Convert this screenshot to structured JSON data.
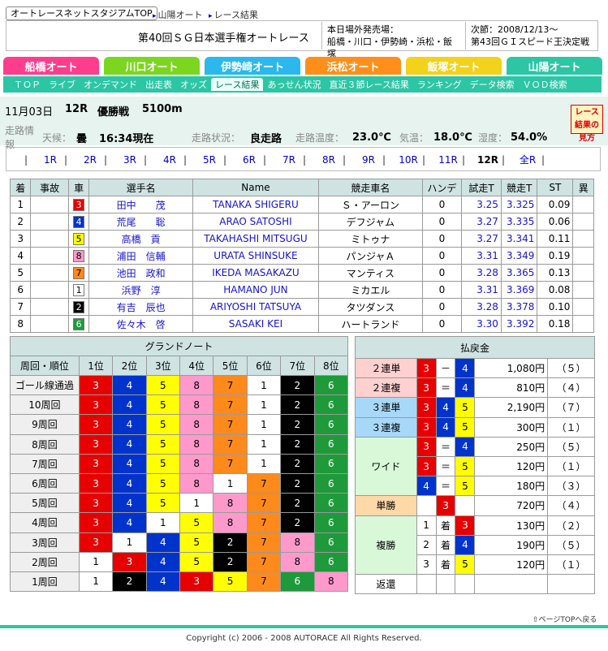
{
  "top": {
    "home_btn": "オートレースネットスタジアムTOP",
    "crumb1": "山陽オート",
    "crumb2": "レース結果"
  },
  "title": "第40回ＳＧ日本選手権オートレース",
  "outside": {
    "label": "本日場外発売場：",
    "venues": "船橋・川口・伊勢崎・浜松・飯塚"
  },
  "next": {
    "label": "次節：2008/12/13～",
    "name": "第43回ＧＩスピード王決定戦"
  },
  "tabs": [
    {
      "label": "船橋オート",
      "color": "#ff3d8c"
    },
    {
      "label": "川口オート",
      "color": "#7cd620"
    },
    {
      "label": "伊勢崎オート",
      "color": "#2ab8ef"
    },
    {
      "label": "浜松オート",
      "color": "#ff8f1a"
    },
    {
      "label": "飯塚オート",
      "color": "#f2d21a"
    },
    {
      "label": "山陽オート",
      "color": "#2cc6a4"
    }
  ],
  "subnav": [
    "ＴＯＰ",
    "ライブ",
    "オンデマンド",
    "出走表",
    "オッズ",
    "レース結果",
    "あっせん状況",
    "直近３節レース結果",
    "ランキング",
    "データ検索",
    "ＶＯＤ検索"
  ],
  "race": {
    "date": "11月03日",
    "no": "12R",
    "type": "優勝戦",
    "dist": "5100m"
  },
  "cond": {
    "info_label": "走路情報",
    "weather_label": "天候：",
    "weather": "曇",
    "time": "16:34現在",
    "state_label": "走路状況：",
    "state": "良走路",
    "temp_label": "走路温度：",
    "temp": "23.0℃",
    "air_label": "気温：",
    "air": "18.0℃",
    "hum_label": "湿度：",
    "hum": "54.0%"
  },
  "guide_btn": "レース結果の見方",
  "races": [
    "1R",
    "2R",
    "3R",
    "4R",
    "5R",
    "6R",
    "7R",
    "8R",
    "9R",
    "10R",
    "11R",
    "12R",
    "全R"
  ],
  "results": {
    "headers": [
      "着",
      "事故",
      "車",
      "選手名",
      "Name",
      "競走車名",
      "ハンデ",
      "試走T",
      "競走T",
      "ST",
      "異"
    ],
    "rows": [
      {
        "pos": "1",
        "car": "3",
        "cc": "c3",
        "name": "田中　　茂",
        "en": "TANAKA SHIGERU",
        "bike": "Ｓ・アーロン",
        "handi": "0",
        "trial": "3.25",
        "race": "3.325",
        "st": "0.09"
      },
      {
        "pos": "2",
        "car": "4",
        "cc": "c4",
        "name": "荒尾　　聡",
        "en": "ARAO SATOSHI",
        "bike": "デフジャム",
        "handi": "0",
        "trial": "3.27",
        "race": "3.335",
        "st": "0.06"
      },
      {
        "pos": "3",
        "car": "5",
        "cc": "c5",
        "name": "高橋　貢",
        "en": "TAKAHASHI MITSUGU",
        "bike": "ミトゥナ",
        "handi": "0",
        "trial": "3.27",
        "race": "3.341",
        "st": "0.11"
      },
      {
        "pos": "4",
        "car": "8",
        "cc": "c8",
        "name": "浦田　信輔",
        "en": "URATA SHINSUKE",
        "bike": "パンジャＡ",
        "handi": "0",
        "trial": "3.31",
        "race": "3.349",
        "st": "0.19"
      },
      {
        "pos": "5",
        "car": "7",
        "cc": "c7",
        "name": "池田　政和",
        "en": "IKEDA MASAKAZU",
        "bike": "マンティス",
        "handi": "0",
        "trial": "3.28",
        "race": "3.365",
        "st": "0.13"
      },
      {
        "pos": "6",
        "car": "1",
        "cc": "c1",
        "name": "浜野　淳",
        "en": "HAMANO JUN",
        "bike": "ミカエル",
        "handi": "0",
        "trial": "3.31",
        "race": "3.369",
        "st": "0.08"
      },
      {
        "pos": "7",
        "car": "2",
        "cc": "c2",
        "name": "有吉　辰也",
        "en": "ARIYOSHI TATSUYA",
        "bike": "タツダンス",
        "handi": "0",
        "trial": "3.28",
        "race": "3.378",
        "st": "0.10"
      },
      {
        "pos": "8",
        "car": "6",
        "cc": "c6",
        "name": "佐々木　啓",
        "en": "SASAKI KEI",
        "bike": "ハートランド",
        "handi": "0",
        "trial": "3.30",
        "race": "3.392",
        "st": "0.18"
      }
    ]
  },
  "grand": {
    "title": "グランドノート",
    "head": [
      "周回・順位",
      "1位",
      "2位",
      "3位",
      "4位",
      "5位",
      "6位",
      "7位",
      "8位"
    ],
    "rows": [
      {
        "label": "ゴール線通過",
        "v": [
          "3",
          "4",
          "5",
          "8",
          "7",
          "1",
          "2",
          "6"
        ]
      },
      {
        "label": "10周回",
        "v": [
          "3",
          "4",
          "5",
          "8",
          "7",
          "1",
          "2",
          "6"
        ]
      },
      {
        "label": "9周回",
        "v": [
          "3",
          "4",
          "5",
          "8",
          "7",
          "1",
          "2",
          "6"
        ]
      },
      {
        "label": "8周回",
        "v": [
          "3",
          "4",
          "5",
          "8",
          "7",
          "1",
          "2",
          "6"
        ]
      },
      {
        "label": "7周回",
        "v": [
          "3",
          "4",
          "5",
          "8",
          "7",
          "1",
          "2",
          "6"
        ]
      },
      {
        "label": "6周回",
        "v": [
          "3",
          "4",
          "5",
          "8",
          "1",
          "7",
          "2",
          "6"
        ]
      },
      {
        "label": "5周回",
        "v": [
          "3",
          "4",
          "5",
          "1",
          "8",
          "7",
          "2",
          "6"
        ]
      },
      {
        "label": "4周回",
        "v": [
          "3",
          "4",
          "1",
          "5",
          "8",
          "7",
          "2",
          "6"
        ]
      },
      {
        "label": "3周回",
        "v": [
          "3",
          "1",
          "4",
          "5",
          "2",
          "7",
          "8",
          "6"
        ]
      },
      {
        "label": "2周回",
        "v": [
          "1",
          "3",
          "4",
          "5",
          "2",
          "7",
          "8",
          "6"
        ]
      },
      {
        "label": "1周回",
        "v": [
          "1",
          "2",
          "4",
          "3",
          "5",
          "7",
          "6",
          "8"
        ]
      }
    ]
  },
  "payout": {
    "title": "払戻金",
    "rows": [
      {
        "type": "２連単",
        "bg": "#ffd0d0",
        "a": "3",
        "sep": "－",
        "b": "4",
        "c": "",
        "amt": "1,080円",
        "pop": "（５）"
      },
      {
        "type": "２連複",
        "bg": "#ffd0d0",
        "a": "3",
        "sep": "＝",
        "b": "4",
        "c": "",
        "amt": "810円",
        "pop": "（４）"
      },
      {
        "type": "３連単",
        "bg": "#a8d8f8",
        "a": "3",
        "sep": "",
        "b": "4",
        "c": "5",
        "amt": "2,190円",
        "pop": "（７）"
      },
      {
        "type": "３連複",
        "bg": "#a8d8f8",
        "a": "3",
        "sep": "",
        "b": "4",
        "c": "5",
        "amt": "300円",
        "pop": "（１）"
      }
    ],
    "wide_label": "ワイド",
    "wide_bg": "#d8f8d8",
    "wide": [
      {
        "a": "3",
        "sep": "＝",
        "b": "4",
        "amt": "250円",
        "pop": "（５）"
      },
      {
        "a": "3",
        "sep": "＝",
        "b": "5",
        "amt": "120円",
        "pop": "（１）"
      },
      {
        "a": "4",
        "sep": "＝",
        "b": "5",
        "amt": "180円",
        "pop": "（３）"
      }
    ],
    "tan_label": "単勝",
    "tan_bg": "#ffd8a8",
    "tan": {
      "a": "3",
      "amt": "720円",
      "pop": "（４）"
    },
    "fuku_label": "複勝",
    "fuku_bg": "#d8f8d8",
    "chaku": "着",
    "fuku": [
      {
        "p": "1",
        "a": "3",
        "amt": "130円",
        "pop": "（２）"
      },
      {
        "p": "2",
        "a": "4",
        "amt": "190円",
        "pop": "（５）"
      },
      {
        "p": "3",
        "a": "5",
        "amt": "120円",
        "pop": "（１）"
      }
    ],
    "henkan": "返還"
  },
  "pagetop": "ページTOPへ戻る",
  "footer": "Copyright (c) 2006 - 2008 AUTORACE All Rights Reserved."
}
